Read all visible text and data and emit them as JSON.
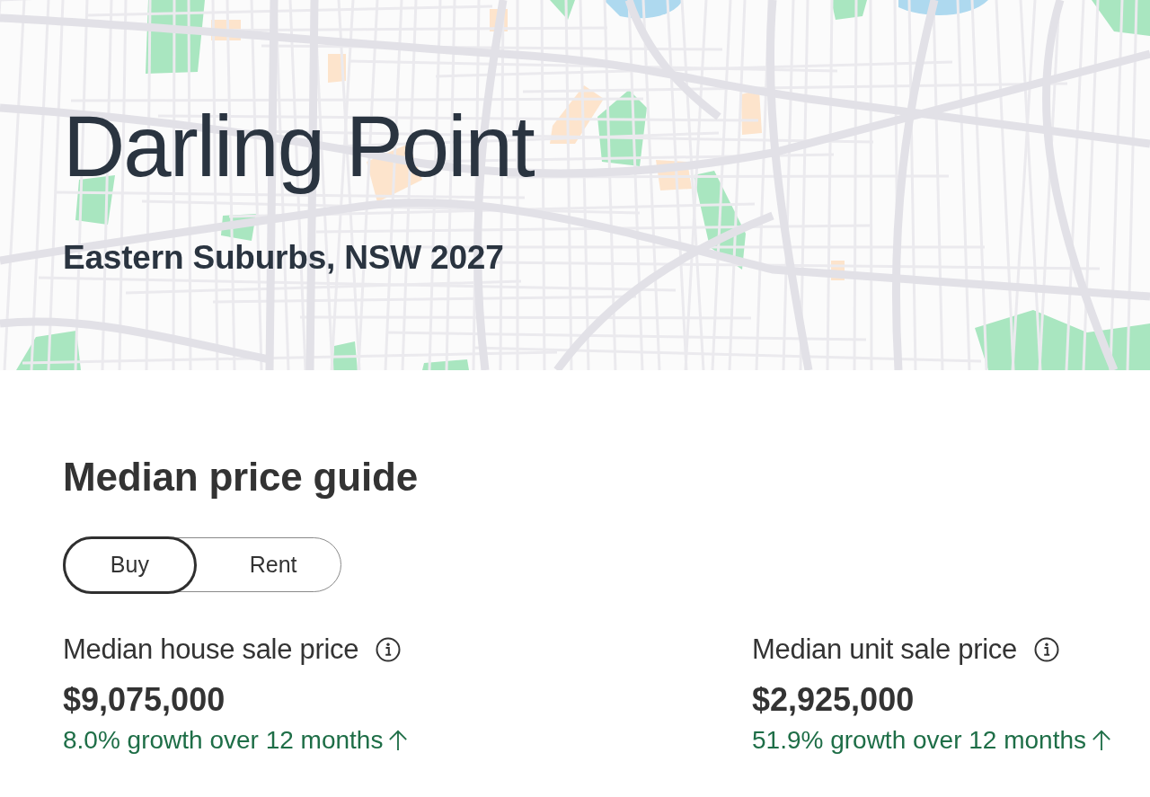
{
  "hero": {
    "title": "Darling Point",
    "subtitle": "Eastern Suburbs, NSW 2027"
  },
  "price_guide": {
    "heading": "Median price guide",
    "tabs": [
      {
        "label": "Buy",
        "selected": true
      },
      {
        "label": "Rent",
        "selected": false
      }
    ],
    "stats": [
      {
        "label": "Median house sale price",
        "value": "$9,075,000",
        "growth": "8.0% growth over 12 months"
      },
      {
        "label": "Median unit sale price",
        "value": "$2,925,000",
        "growth": "51.9% growth over 12 months"
      }
    ]
  }
}
